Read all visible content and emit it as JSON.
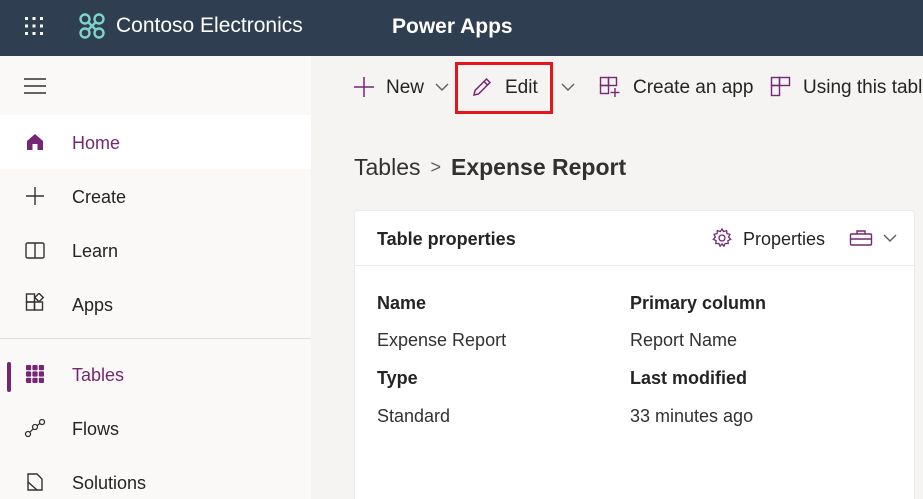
{
  "header": {
    "brand": "Contoso Electronics",
    "app": "Power Apps",
    "colors": {
      "bar": "#2f3f51",
      "accent": "#742774"
    }
  },
  "sidebar": {
    "items": [
      {
        "label": "Home",
        "icon": "home-icon"
      },
      {
        "label": "Create",
        "icon": "plus-icon"
      },
      {
        "label": "Learn",
        "icon": "book-icon"
      },
      {
        "label": "Apps",
        "icon": "apps-icon"
      },
      {
        "label": "Tables",
        "icon": "table-grid-icon"
      },
      {
        "label": "Flows",
        "icon": "flows-icon"
      },
      {
        "label": "Solutions",
        "icon": "solutions-icon"
      }
    ]
  },
  "commandbar": {
    "new_label": "New",
    "edit_label": "Edit",
    "create_app_label": "Create an app",
    "using_table_label": "Using this table",
    "highlight_color": "#e3161b"
  },
  "breadcrumb": {
    "root": "Tables",
    "separator": ">",
    "current": "Expense Report"
  },
  "card": {
    "title": "Table properties",
    "properties_label": "Properties",
    "fields": {
      "name_label": "Name",
      "name_value": "Expense Report",
      "primary_label": "Primary column",
      "primary_value": "Report Name",
      "type_label": "Type",
      "type_value": "Standard",
      "modified_label": "Last modified",
      "modified_value": "33 minutes ago"
    }
  }
}
